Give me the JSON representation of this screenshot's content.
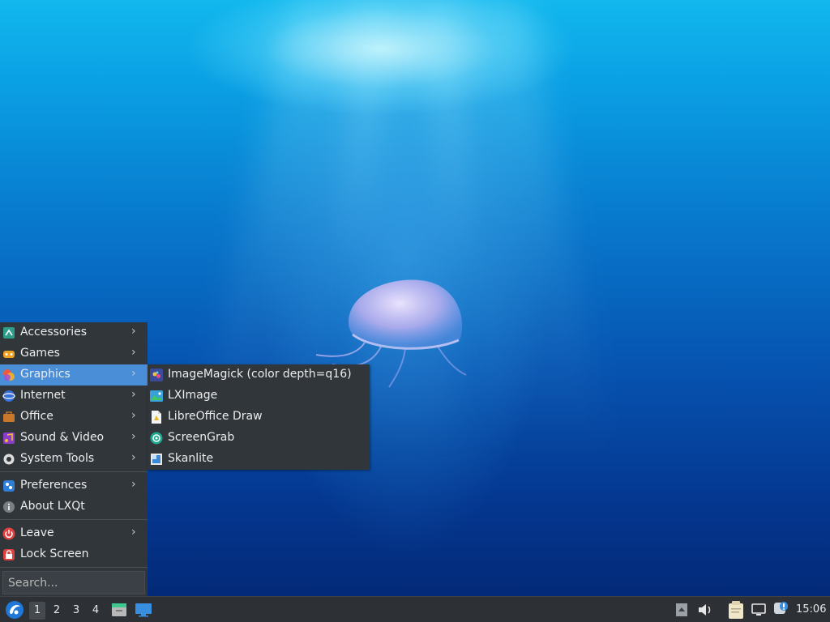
{
  "desktop": {
    "wallpaper": "underwater-jellyfish"
  },
  "menu": {
    "categories": [
      {
        "label": "Accessories",
        "icon": "accessories-icon"
      },
      {
        "label": "Games",
        "icon": "games-icon"
      },
      {
        "label": "Graphics",
        "icon": "graphics-icon",
        "active": true
      },
      {
        "label": "Internet",
        "icon": "internet-icon"
      },
      {
        "label": "Office",
        "icon": "office-icon"
      },
      {
        "label": "Sound & Video",
        "icon": "multimedia-icon"
      },
      {
        "label": "System Tools",
        "icon": "system-tools-icon"
      }
    ],
    "preferences": "Preferences",
    "about": "About LXQt",
    "leave": "Leave",
    "lock": "Lock Screen",
    "search_placeholder": "Search..."
  },
  "submenu": {
    "items": [
      {
        "label": "ImageMagick (color depth=q16)",
        "icon": "imagemagick-icon"
      },
      {
        "label": "LXImage",
        "icon": "lximage-icon"
      },
      {
        "label": "LibreOffice Draw",
        "icon": "libreoffice-draw-icon"
      },
      {
        "label": "ScreenGrab",
        "icon": "screengrab-icon"
      },
      {
        "label": "Skanlite",
        "icon": "skanlite-icon"
      }
    ]
  },
  "taskbar": {
    "desktops": [
      "1",
      "2",
      "3",
      "4"
    ],
    "active_desktop": "1",
    "clock": "15:06"
  },
  "colors": {
    "menu_bg": "#31363b",
    "highlight": "#4a8ed8",
    "taskbar_bg": "#2d3136"
  }
}
